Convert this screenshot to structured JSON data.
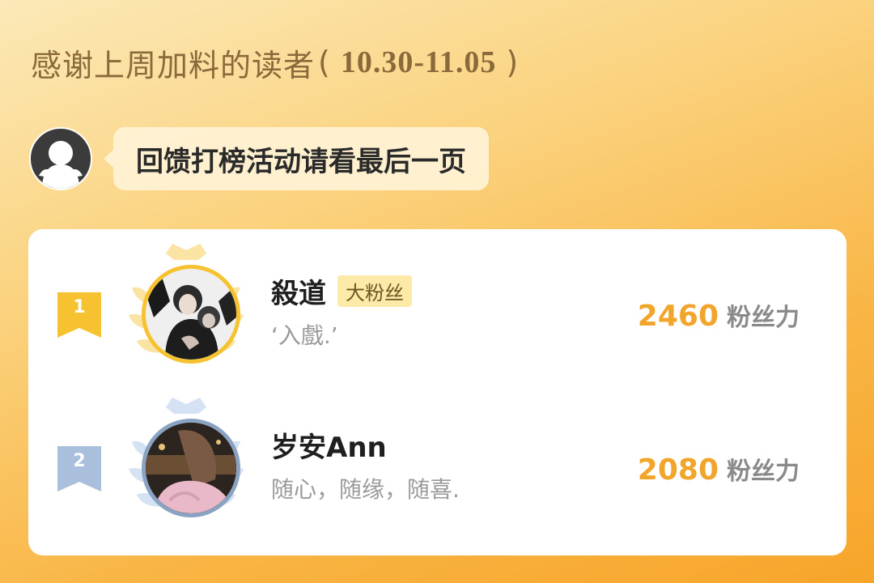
{
  "header": {
    "title": "感谢上周加料的读者",
    "paren_open": "(",
    "date_range": "10.30-11.05",
    "paren_close": ")"
  },
  "bot": {
    "avatar_icon": "ghost-avatar-icon",
    "message": "回馈打榜活动请看最后一页"
  },
  "ranking": [
    {
      "rank": "1",
      "name": "殺道",
      "tag": "大粉丝",
      "signature": "‘入戲.’",
      "score": "2460",
      "unit": "粉丝力",
      "badge_color": "#f6c22f",
      "ring_color": "#f6c22f"
    },
    {
      "rank": "2",
      "name": "岁安Ann",
      "signature": "随心，随缘，随喜.",
      "score": "2080",
      "unit": "粉丝力",
      "badge_color": "#a9bfdc",
      "ring_color": "#8aa3c2"
    }
  ],
  "colors": {
    "accent": "#f2a52b",
    "background_start": "#fbe9b8",
    "background_end": "#f7a52a"
  }
}
